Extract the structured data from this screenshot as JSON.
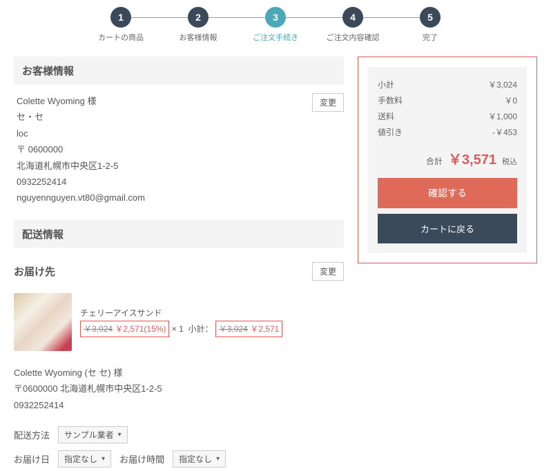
{
  "steps": [
    {
      "num": "1",
      "label": "カートの商品"
    },
    {
      "num": "2",
      "label": "お客様情報"
    },
    {
      "num": "3",
      "label": "ご注文手続き"
    },
    {
      "num": "4",
      "label": "ご注文内容確認"
    },
    {
      "num": "5",
      "label": "完了"
    }
  ],
  "customer": {
    "header": "お客様情報",
    "change_btn": "変更",
    "name": "Colette Wyoming 様",
    "kana": "セ・セ",
    "loc": "loc",
    "zip": "〒 0600000",
    "addr": "北海道札幌市中央区1-2-5",
    "tel": "0932252414",
    "email": "nguyennguyen.vt80@gmail.com"
  },
  "shipping": {
    "header": "配送情報",
    "dest_header": "お届け先",
    "change_btn": "変更",
    "product": {
      "name": "チェリーアイスサンド",
      "orig_price": "￥3,024",
      "sale_price": "￥2,571(15%)",
      "qty_sep": "× 1",
      "subtotal_label": "小計：",
      "sub_orig": "￥3,024",
      "sub_sale": "￥2,571"
    },
    "addr": {
      "name": "Colette Wyoming (セ セ) 様",
      "line": "〒0600000 北海道札幌市中央区1-2-5",
      "tel": "0932252414"
    },
    "method_label": "配送方法",
    "method_value": "サンプル業者",
    "date_label": "お届け日",
    "date_value": "指定なし",
    "time_label": "お届け時間",
    "time_value": "指定なし"
  },
  "summary": {
    "rows": [
      {
        "label": "小計",
        "value": "￥3,024"
      },
      {
        "label": "手数料",
        "value": "￥0"
      },
      {
        "label": "送料",
        "value": "￥1,000"
      },
      {
        "label": "値引き",
        "value": "-￥453"
      }
    ],
    "total_label": "合計",
    "total_amount": "￥3,571",
    "tax_label": "税込",
    "confirm_btn": "確認する",
    "back_btn": "カートに戻る"
  },
  "chart_data": null
}
